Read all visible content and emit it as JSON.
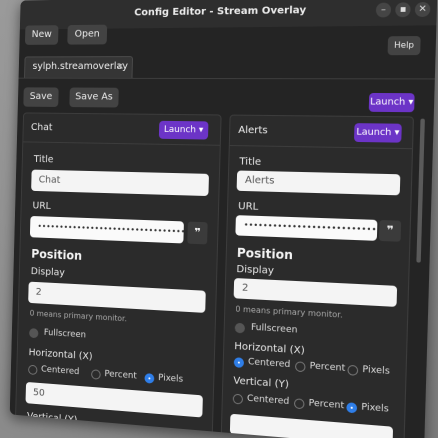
{
  "window": {
    "title": "Config Editor - Stream Overlay"
  },
  "toolbar": {
    "new_label": "New",
    "open_label": "Open",
    "help_label": "Help"
  },
  "tabs": [
    {
      "label": "sylph.streamoverlay",
      "close": "×"
    }
  ],
  "actions": {
    "save_label": "Save",
    "save_as_label": "Save As",
    "launch_label": "Launch ▾"
  },
  "panels": [
    {
      "name": "Chat",
      "launch_label": "Launch ▾",
      "title_label": "Title",
      "title_value": "Chat",
      "url_label": "URL",
      "url_value": "••••••••••••••••••••••••••••••••••••",
      "position_heading": "Position",
      "display_label": "Display",
      "display_value": "2",
      "display_hint": "0 means primary monitor.",
      "fullscreen_label": "Fullscreen",
      "horizontal_label": "Horizontal (X)",
      "options": [
        "Centered",
        "Percent",
        "Pixels"
      ],
      "horizontal_selected": "Pixels",
      "horizontal_value": "50",
      "vertical_label": "Vertical (Y)"
    },
    {
      "name": "Alerts",
      "launch_label": "Launch ▾",
      "title_label": "Title",
      "title_value": "Alerts",
      "url_label": "URL",
      "url_value": "••••••••••••••••••••••••••••••••",
      "position_heading": "Position",
      "display_label": "Display",
      "display_value": "2",
      "display_hint": "0 means primary monitor.",
      "fullscreen_label": "Fullscreen",
      "horizontal_label": "Horizontal (X)",
      "options": [
        "Centered",
        "Percent",
        "Pixels"
      ],
      "horizontal_selected": "Centered",
      "vertical_label": "Vertical (Y)",
      "vertical_selected": "Pixels"
    }
  ],
  "icons": {
    "reveal": "eye-icon",
    "close": "close-icon",
    "minimize": "minimize-icon",
    "maximize": "maximize-icon"
  },
  "colors": {
    "accent": "#6c34c7",
    "radio_selected": "#2f7ee8",
    "window_bg": "#242424"
  }
}
